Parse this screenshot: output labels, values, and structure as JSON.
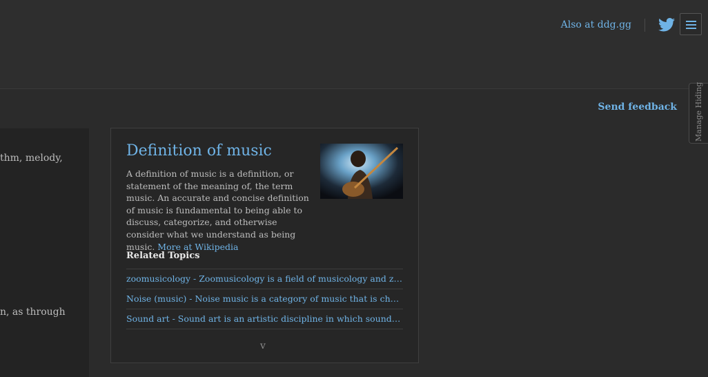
{
  "header": {
    "also_link": "Also at ddg.gg",
    "twitter_icon": "twitter-bird-icon",
    "menu_icon": "hamburger-menu-icon",
    "accent_color": "#6fb3e6"
  },
  "feedback": {
    "label": "Send feedback"
  },
  "sidebar_tab": {
    "label": "Manage Hiding"
  },
  "left_fragments": [
    "thm, melody,",
    "n, as through"
  ],
  "card": {
    "title": "Definition of music",
    "abstract": "A definition of music is a definition, or statement of the meaning of, the term music. An accurate and concise definition of music is fundamental to being able to discuss, categorize, and otherwise consider what we understand as being music.",
    "more_link": "More at Wikipedia",
    "related_heading": "Related Topics",
    "topics": [
      "zoomusicology - Zoomusicology is a field of musicology and zoology or...",
      "Noise (music) - Noise music is a category of music that is characterise...",
      "Sound art - Sound art is an artistic discipline in which sound is utilise..."
    ],
    "toggle": "v"
  }
}
